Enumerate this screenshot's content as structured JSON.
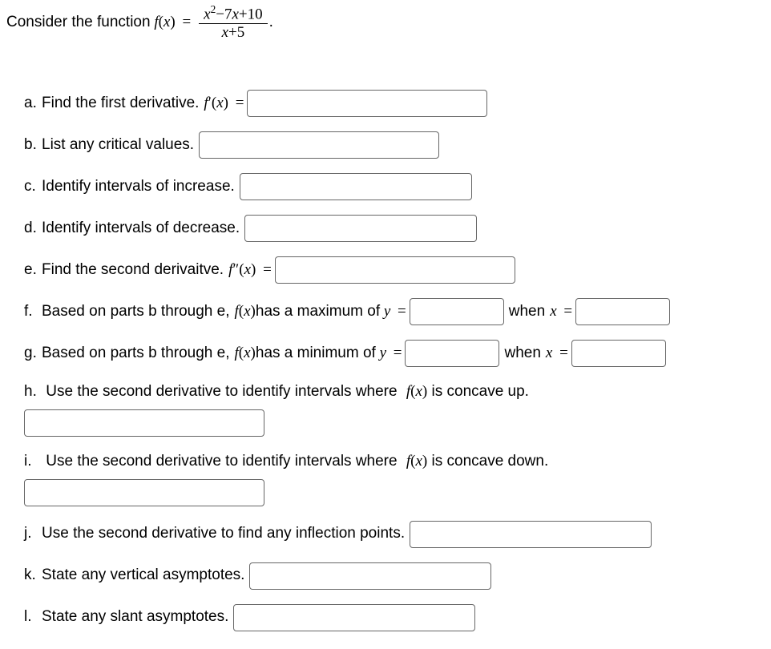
{
  "intro_text": "Consider the function ",
  "func_lhs": "f(x) =",
  "frac_numerator_terms": [
    "x",
    "2",
    " − 7",
    "x",
    " + 10"
  ],
  "frac_denominator_terms": [
    "x",
    " + 5"
  ],
  "period": ".",
  "items": {
    "a": {
      "label": "a.",
      "text": "Find the first derivative. ",
      "math": "f′(x) ="
    },
    "b": {
      "label": "b.",
      "text": "List any critical values."
    },
    "c": {
      "label": "c.",
      "text": "Identify intervals of increase."
    },
    "d": {
      "label": "d.",
      "text": "Identify intervals of decrease."
    },
    "e": {
      "label": "e.",
      "text": "Find the second derivaitve. ",
      "math": "f″(x) ="
    },
    "f": {
      "label": "f.",
      "text": "Based on parts b through e, ",
      "math1": "f(x)",
      "text2": " has a maximum of ",
      "math2": "y =",
      "text3": " when ",
      "math3": "x ="
    },
    "g": {
      "label": "g.",
      "text": "Based on parts b through e, ",
      "math1": "f(x)",
      "text2": " has a minimum of ",
      "math2": "y =",
      "text3": " when ",
      "math3": "x ="
    },
    "h": {
      "label": "h.",
      "text": "Use the second derivative to identify intervals where ",
      "math": "f(x)",
      "text2": " is concave up."
    },
    "i": {
      "label": "i.",
      "text": "Use the second derivative to identify intervals where ",
      "math": "f(x)",
      "text2": " is concave down."
    },
    "j": {
      "label": "j.",
      "text": "Use the second derivative to find any inflection points."
    },
    "k": {
      "label": "k.",
      "text": "State any vertical asymptotes."
    },
    "l": {
      "label": "l.",
      "text": "State any slant asymptotes."
    }
  }
}
